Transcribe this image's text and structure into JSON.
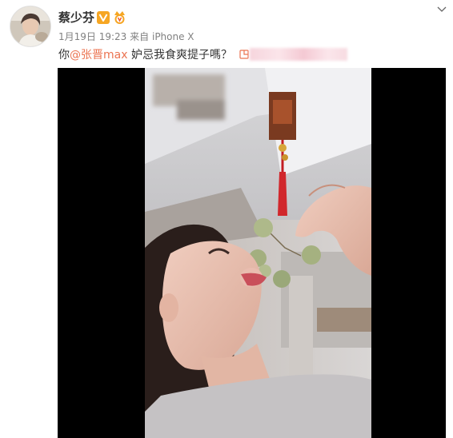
{
  "post": {
    "author": "蔡少芬",
    "timestamp": "1月19日 19:23",
    "source_prefix": "来自",
    "source_device": "iPhone X",
    "text_prefix": "你",
    "mention": "@张晋max",
    "text_body": " 妒忌我食爽提子嗎？",
    "link_icon": "link-icon"
  },
  "icons": {
    "verified": "verified-v-icon",
    "vip": "vip-crown-icon",
    "menu": "chevron-down-icon"
  },
  "colors": {
    "mention": "#eb7350",
    "meta": "#808080",
    "verified_badge": "#f6a623"
  }
}
